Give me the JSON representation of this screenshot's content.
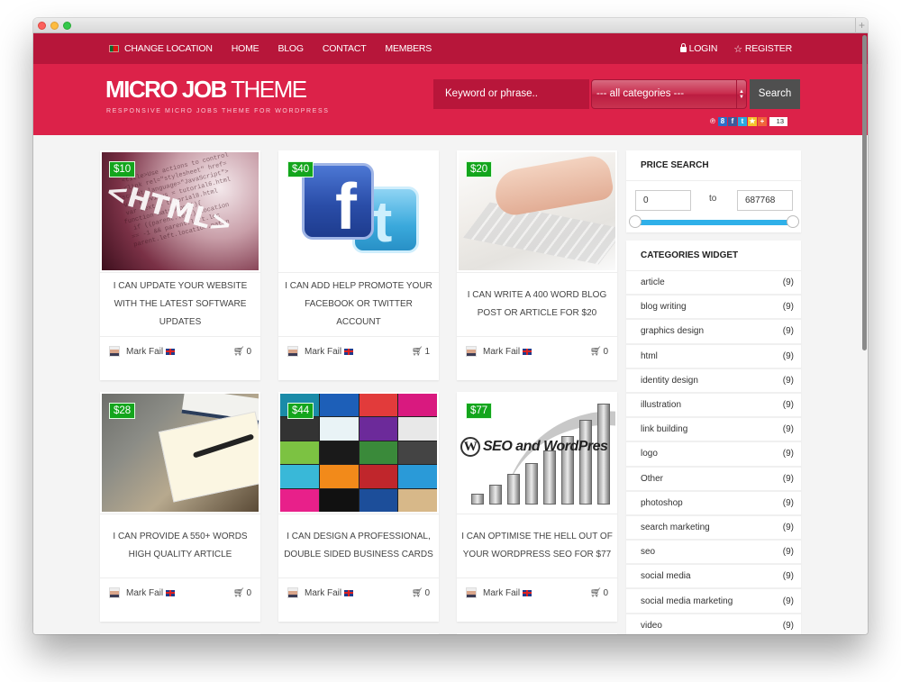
{
  "topnav": {
    "left": [
      {
        "label": "CHANGE LOCATION",
        "icon": "flag-portugal-icon"
      },
      {
        "label": "HOME"
      },
      {
        "label": "BLOG"
      },
      {
        "label": "CONTACT"
      },
      {
        "label": "MEMBERS"
      }
    ],
    "right": [
      {
        "label": "LOGIN",
        "icon": "lock-icon"
      },
      {
        "label": "REGISTER",
        "icon": "star-icon"
      }
    ]
  },
  "header": {
    "logo_bold": "MICRO JOB",
    "logo_thin": " THEME",
    "tagline": "RESPONSIVE MICRO JOBS THEME FOR WORDPRESS",
    "search": {
      "placeholder": "Keyword or phrase..",
      "category_selected": "--- all categories ---",
      "button_label": "Search"
    },
    "social": {
      "icons": [
        "pinterest-icon",
        "google-plus-icon",
        "facebook-icon",
        "twitter-icon",
        "favorite-icon",
        "addthis-icon"
      ],
      "share_count": "13"
    }
  },
  "jobs": [
    {
      "price": "$10",
      "title": "I CAN UPDATE YOUR WEBSITE WITH THE LATEST SOFTWARE UPDATES",
      "author": "Mark Fail",
      "orders": "0",
      "image": "html-code-image"
    },
    {
      "price": "$40",
      "title": "I CAN ADD HELP PROMOTE YOUR FACEBOOK OR TWITTER ACCOUNT",
      "author": "Mark Fail",
      "orders": "1",
      "image": "facebook-twitter-image"
    },
    {
      "price": "$20",
      "title": "I CAN WRITE A 400 WORD BLOG POST OR ARTICLE FOR $20",
      "author": "Mark Fail",
      "orders": "0",
      "image": "typing-hands-image"
    },
    {
      "price": "$28",
      "title": "I CAN PROVIDE A 550+ WORDS HIGH QUALITY ARTICLE",
      "author": "Mark Fail",
      "orders": "0",
      "image": "laptop-notes-image"
    },
    {
      "price": "$44",
      "title": "I CAN DESIGN A PROFESSIONAL, DOUBLE SIDED BUSINESS CARDS",
      "author": "Mark Fail",
      "orders": "0",
      "image": "business-cards-image"
    },
    {
      "price": "$77",
      "title": "I CAN OPTIMISE THE HELL OUT OF YOUR WORDPRESS SEO FOR $77",
      "author": "Mark Fail",
      "orders": "0",
      "image": "seo-wordpress-image",
      "image_text": "SEO and WordPres"
    }
  ],
  "sidebar": {
    "price_search": {
      "title": "PRICE SEARCH",
      "min": "0",
      "max": "687768",
      "to_label": "to"
    },
    "categories": {
      "title": "CATEGORIES WIDGET",
      "items": [
        {
          "label": "article",
          "count": "(9)"
        },
        {
          "label": "blog writing",
          "count": "(9)"
        },
        {
          "label": "graphics design",
          "count": "(9)"
        },
        {
          "label": "html",
          "count": "(9)"
        },
        {
          "label": "identity design",
          "count": "(9)"
        },
        {
          "label": "illustration",
          "count": "(9)"
        },
        {
          "label": "link building",
          "count": "(9)"
        },
        {
          "label": "logo",
          "count": "(9)"
        },
        {
          "label": "Other",
          "count": "(9)"
        },
        {
          "label": "photoshop",
          "count": "(9)"
        },
        {
          "label": "search marketing",
          "count": "(9)"
        },
        {
          "label": "seo",
          "count": "(9)"
        },
        {
          "label": "social media",
          "count": "(9)"
        },
        {
          "label": "social media marketing",
          "count": "(9)"
        },
        {
          "label": "video",
          "count": "(9)"
        }
      ]
    }
  },
  "colors": {
    "nav_bg": "#b7163a",
    "header_bg": "#dc2249",
    "price_badge": "#13a51c",
    "slider": "#2fb0e9",
    "search_button": "#4f4f4f"
  }
}
